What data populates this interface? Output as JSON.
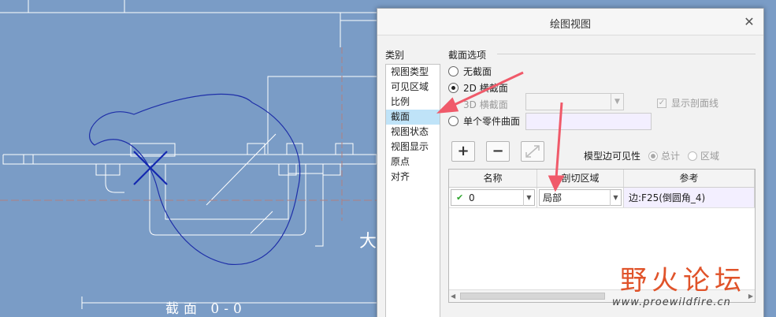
{
  "dialog": {
    "title": "绘图视图",
    "close_glyph": "✕"
  },
  "categories": {
    "heading": "类别",
    "items": [
      "视图类型",
      "可见区域",
      "比例",
      "截面",
      "视图状态",
      "视图显示",
      "原点",
      "对齐"
    ],
    "selected": "截面"
  },
  "section_options": {
    "heading": "截面选项",
    "no_section": "无截面",
    "section_2d": "2D 横截面",
    "section_3d": "3D 横截面",
    "single_part_surface": "单个零件曲面",
    "selected": "2D 横截面",
    "show_hatch_label": "显示剖面线",
    "show_hatch_checked": true
  },
  "toolbar": {
    "add_icon": "plus-icon",
    "remove_icon": "minus-icon",
    "flip_icon": "flip-icon"
  },
  "edge_visibility": {
    "label": "模型边可见性",
    "option_total": "总计",
    "option_area": "区域",
    "selected": "总计"
  },
  "table": {
    "headers": [
      "名称",
      "剖切区域",
      "参考"
    ],
    "rows": [
      {
        "name": "0",
        "region": "局部",
        "reference": "边:F25(倒圆角_4)"
      }
    ]
  },
  "background": {
    "section_label": "截面 0-0",
    "glyph": "大"
  },
  "watermark": {
    "brand": "野火论坛",
    "url": "www.proewildfire.cn"
  },
  "colors": {
    "canvas": "#7a9cc6",
    "selection": "#bfe3f8",
    "annotation": "#f05a6a",
    "watermark": "#e0532a"
  }
}
